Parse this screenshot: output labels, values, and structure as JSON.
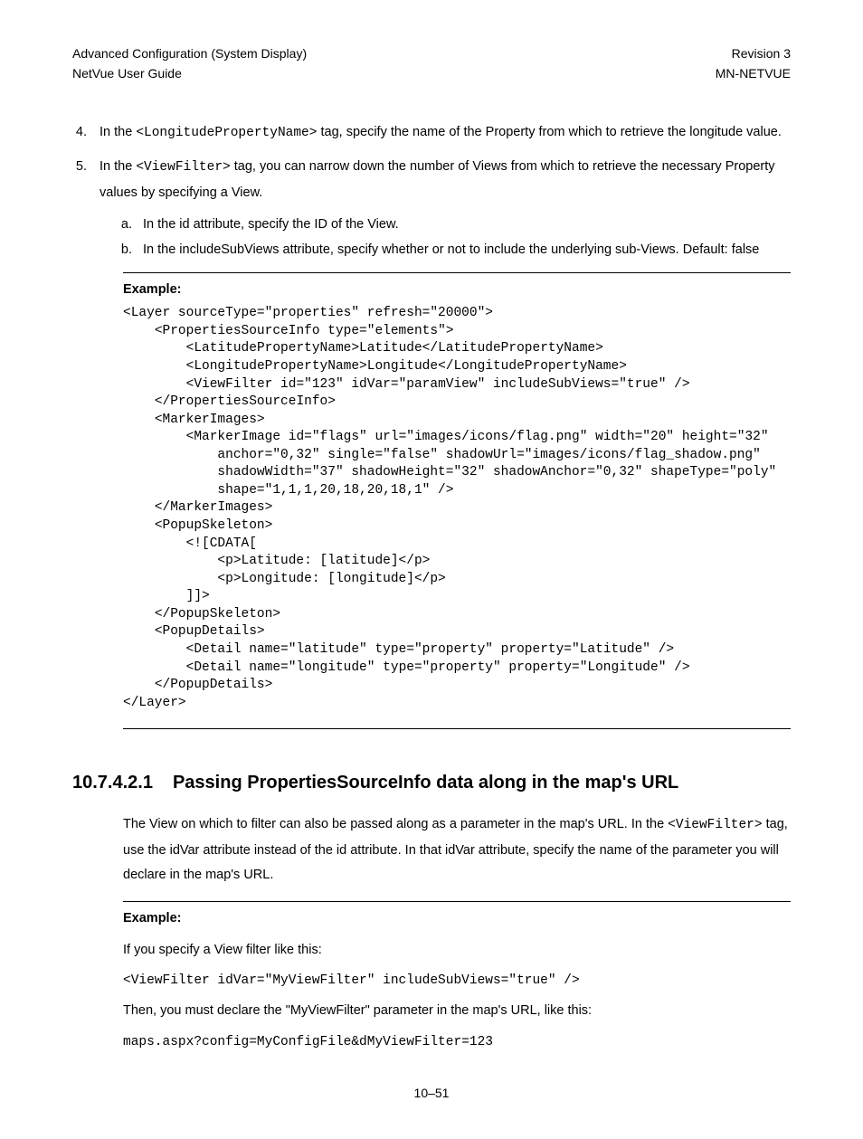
{
  "header": {
    "left1": "Advanced Configuration (System Display)",
    "left2": "NetVue User Guide",
    "right1": "Revision 3",
    "right2": "MN-NETVUE"
  },
  "list": {
    "item4": {
      "pre": "In the ",
      "tag": "<LongitudePropertyName>",
      "post": " tag, specify the name of the Property from which to retrieve the longitude value."
    },
    "item5": {
      "pre": "In the ",
      "tag": "<ViewFilter>",
      "post": " tag, you can narrow down the number of Views from which to retrieve the necessary Property values by specifying a View.",
      "sub_a": "In the id attribute, specify the ID of the View.",
      "sub_b": "In the includeSubViews attribute, specify whether or not to include the underlying sub-Views. Default: false"
    }
  },
  "example1": {
    "label": "Example:",
    "code": "<Layer sourceType=\"properties\" refresh=\"20000\">\n    <PropertiesSourceInfo type=\"elements\">\n        <LatitudePropertyName>Latitude</LatitudePropertyName>\n        <LongitudePropertyName>Longitude</LongitudePropertyName>\n        <ViewFilter id=\"123\" idVar=\"paramView\" includeSubViews=\"true\" />\n    </PropertiesSourceInfo>\n    <MarkerImages>\n        <MarkerImage id=\"flags\" url=\"images/icons/flag.png\" width=\"20\" height=\"32\"\n            anchor=\"0,32\" single=\"false\" shadowUrl=\"images/icons/flag_shadow.png\"\n            shadowWidth=\"37\" shadowHeight=\"32\" shadowAnchor=\"0,32\" shapeType=\"poly\"\n            shape=\"1,1,1,20,18,20,18,1\" />\n    </MarkerImages>\n    <PopupSkeleton>\n        <![CDATA[\n            <p>Latitude: [latitude]</p>\n            <p>Longitude: [longitude]</p>\n        ]]>\n    </PopupSkeleton>\n    <PopupDetails>\n        <Detail name=\"latitude\" type=\"property\" property=\"Latitude\" />\n        <Detail name=\"longitude\" type=\"property\" property=\"Longitude\" />\n    </PopupDetails>\n</Layer>"
  },
  "section": {
    "number": "10.7.4.2.1",
    "title": "Passing PropertiesSourceInfo data along in the map's URL"
  },
  "para1": {
    "p1": "The View on which to filter can also be passed along as a parameter in the map's URL. In the ",
    "tag": "<ViewFilter>",
    "p2": " tag, use the idVar attribute instead of the id attribute. In that idVar attribute, specify the name of the parameter you will declare in the map's URL."
  },
  "example2": {
    "label": "Example:",
    "intro": "If you specify a View filter like this:",
    "code1": "<ViewFilter idVar=\"MyViewFilter\" includeSubViews=\"true\" />",
    "then": "Then, you must declare the \"MyViewFilter\" parameter in the map's URL, like this:",
    "code2": "maps.aspx?config=MyConfigFile&dMyViewFilter=123"
  },
  "page_num": "10–51"
}
